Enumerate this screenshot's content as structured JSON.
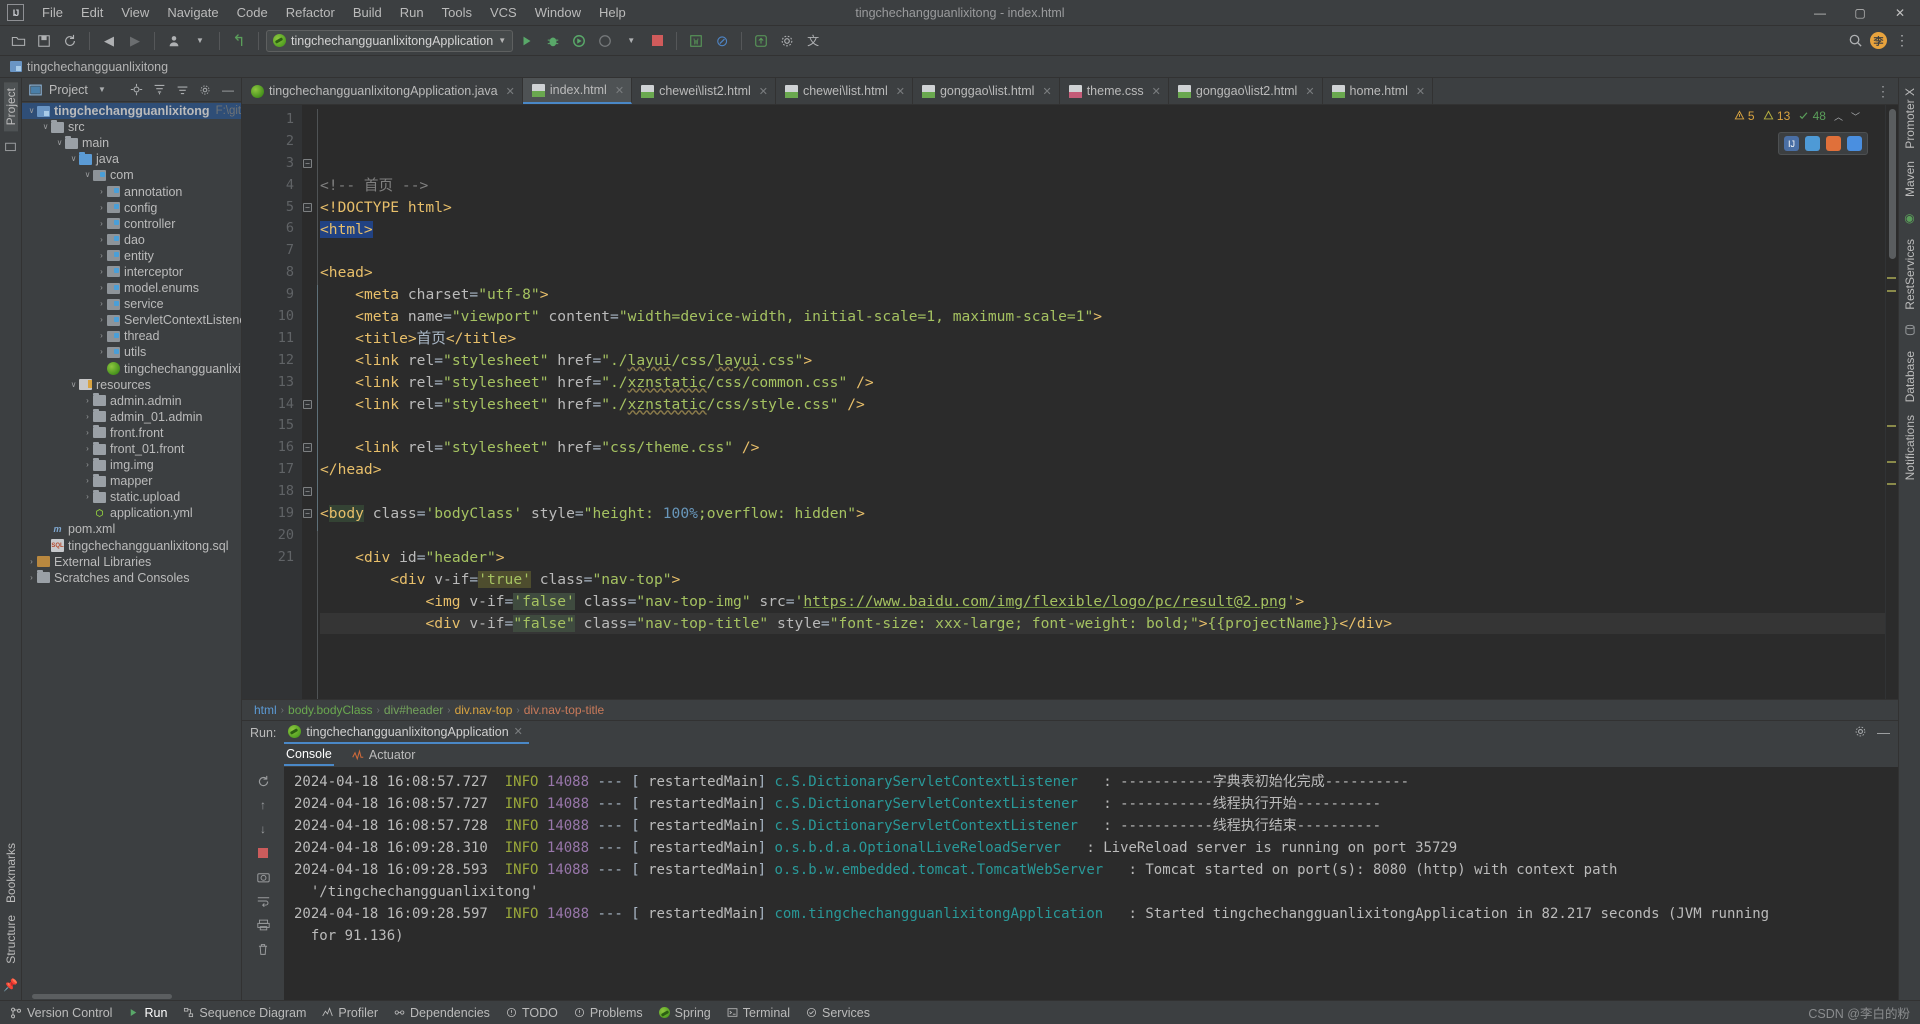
{
  "window": {
    "app_icon": "IJ",
    "title": "tingchechangguanlixitong - index.html",
    "minimize": "—",
    "maximize": "▢",
    "close": "✕"
  },
  "menu": [
    "File",
    "Edit",
    "View",
    "Navigate",
    "Code",
    "Refactor",
    "Build",
    "Run",
    "Tools",
    "VCS",
    "Window",
    "Help"
  ],
  "toolbar": {
    "open_icon": "open-folder-icon",
    "save_icon": "save-icon",
    "sync_icon": "sync-icon",
    "back_icon": "◀",
    "forward_icon": "▶",
    "profile_icon": "user-icon",
    "undo_icon": "↰",
    "run_config": "tingchechangguanlixitongApplication",
    "run_icon": "▶",
    "debug_icon": "debug-icon",
    "run_coverage_icon": "coverage-icon",
    "profiler_icon": "profiler-icon",
    "stop_icon": "stop-icon",
    "w_icon": "W",
    "ban_icon": "⊘",
    "update_icon": "update-icon",
    "settings_icon": "gear-icon",
    "translate_icon": "translate-icon",
    "search_icon": "search-icon",
    "avatar": "李"
  },
  "navbar": {
    "module": "tingchechangguanlixitong"
  },
  "left_rail": {
    "project_label": "Project",
    "structure_label": "Structure",
    "bookmarks_label": "Bookmarks"
  },
  "right_rail": {
    "items": [
      "Promoter X",
      "Maven",
      "RestServices",
      "Database",
      "Notifications"
    ]
  },
  "project_panel": {
    "title": "Project",
    "icons": [
      "locate-icon",
      "expand-all-icon",
      "collapse-all-icon",
      "gear-icon",
      "hide-icon"
    ],
    "tree": [
      {
        "label": "tingchechangguanlixitong",
        "path": "F:\\gitee_w",
        "depth": 0,
        "arrow": "v",
        "icon": "f-mod",
        "selected": true,
        "bold": true
      },
      {
        "label": "src",
        "depth": 1,
        "arrow": "v",
        "icon": "f-gray"
      },
      {
        "label": "main",
        "depth": 2,
        "arrow": "v",
        "icon": "f-gray"
      },
      {
        "label": "java",
        "depth": 3,
        "arrow": "v",
        "icon": "f-blue"
      },
      {
        "label": "com",
        "depth": 4,
        "arrow": "v",
        "icon": "f-pkg"
      },
      {
        "label": "annotation",
        "depth": 5,
        "arrow": ">",
        "icon": "f-pkg"
      },
      {
        "label": "config",
        "depth": 5,
        "arrow": ">",
        "icon": "f-pkg"
      },
      {
        "label": "controller",
        "depth": 5,
        "arrow": ">",
        "icon": "f-pkg"
      },
      {
        "label": "dao",
        "depth": 5,
        "arrow": ">",
        "icon": "f-pkg"
      },
      {
        "label": "entity",
        "depth": 5,
        "arrow": ">",
        "icon": "f-pkg"
      },
      {
        "label": "interceptor",
        "depth": 5,
        "arrow": ">",
        "icon": "f-pkg"
      },
      {
        "label": "model.enums",
        "depth": 5,
        "arrow": ">",
        "icon": "f-pkg"
      },
      {
        "label": "service",
        "depth": 5,
        "arrow": ">",
        "icon": "f-pkg"
      },
      {
        "label": "ServletContextListener",
        "depth": 5,
        "arrow": ">",
        "icon": "f-pkg"
      },
      {
        "label": "thread",
        "depth": 5,
        "arrow": ">",
        "icon": "f-pkg"
      },
      {
        "label": "utils",
        "depth": 5,
        "arrow": ">",
        "icon": "f-pkg"
      },
      {
        "label": "tingchechangguanlixito",
        "depth": 5,
        "arrow": "",
        "icon": "spring"
      },
      {
        "label": "resources",
        "depth": 3,
        "arrow": "v",
        "icon": "f-res"
      },
      {
        "label": "admin.admin",
        "depth": 4,
        "arrow": ">",
        "icon": "f-gray"
      },
      {
        "label": "admin_01.admin",
        "depth": 4,
        "arrow": ">",
        "icon": "f-gray"
      },
      {
        "label": "front.front",
        "depth": 4,
        "arrow": ">",
        "icon": "f-gray"
      },
      {
        "label": "front_01.front",
        "depth": 4,
        "arrow": ">",
        "icon": "f-gray"
      },
      {
        "label": "img.img",
        "depth": 4,
        "arrow": ">",
        "icon": "f-gray"
      },
      {
        "label": "mapper",
        "depth": 4,
        "arrow": ">",
        "icon": "f-gray"
      },
      {
        "label": "static.upload",
        "depth": 4,
        "arrow": ">",
        "icon": "f-gray"
      },
      {
        "label": "application.yml",
        "depth": 4,
        "arrow": "",
        "icon": "yml"
      },
      {
        "label": "pom.xml",
        "depth": 1,
        "arrow": "",
        "icon": "xml"
      },
      {
        "label": "tingchechangguanlixitong.sql",
        "depth": 1,
        "arrow": "",
        "icon": "sql"
      },
      {
        "label": "External Libraries",
        "depth": 0,
        "arrow": ">",
        "icon": "f-lib"
      },
      {
        "label": "Scratches and Consoles",
        "depth": 0,
        "arrow": ">",
        "icon": "f-gray"
      }
    ]
  },
  "editor": {
    "tabs": [
      {
        "label": "tingchechangguanlixitongApplication.java",
        "icon": "spring-icon",
        "active": false
      },
      {
        "label": "index.html",
        "icon": "html-icon",
        "active": true
      },
      {
        "label": "chewei\\list2.html",
        "icon": "html-icon",
        "active": false
      },
      {
        "label": "chewei\\list.html",
        "icon": "html-icon",
        "active": false
      },
      {
        "label": "gonggao\\list.html",
        "icon": "html-icon",
        "active": false
      },
      {
        "label": "theme.css",
        "icon": "css-icon",
        "active": false
      },
      {
        "label": "gonggao\\list2.html",
        "icon": "html-icon",
        "active": false
      },
      {
        "label": "home.html",
        "icon": "html-icon",
        "active": false
      }
    ],
    "inspections": {
      "errors": "5",
      "warnings": "13",
      "weak": "48",
      "chevron_up": "︿",
      "chevron_down": "﹀"
    },
    "line_numbers": [
      "1",
      "2",
      "3",
      "4",
      "5",
      "6",
      "7",
      "8",
      "9",
      "10",
      "11",
      "12",
      "13",
      "14",
      "15",
      "16",
      "17",
      "18",
      "19",
      "20",
      "21"
    ],
    "breadcrumb": [
      "html",
      "body.bodyClass",
      "div#header",
      "div.nav-top",
      "div.nav-top-title"
    ],
    "code_lines": [
      "<!-- 首页 -->",
      "<!DOCTYPE html>",
      "<html>",
      "",
      "<head>",
      "    <meta charset=\"utf-8\">",
      "    <meta name=\"viewport\" content=\"width=device-width, initial-scale=1, maximum-scale=1\">",
      "    <title>首页</title>",
      "    <link rel=\"stylesheet\" href=\"./layui/css/layui.css\">",
      "    <link rel=\"stylesheet\" href=\"./xznstatic/css/common.css\" />",
      "    <link rel=\"stylesheet\" href=\"./xznstatic/css/style.css\" />",
      "",
      "    <link rel=\"stylesheet\" href=\"css/theme.css\" />",
      "</head>",
      "",
      "<body class='bodyClass' style=\"height: 100%;overflow: hidden\">",
      "",
      "    <div id=\"header\">",
      "        <div v-if='true' class=\"nav-top\">",
      "            <img v-if='false' class=\"nav-top-img\" src='https://www.baidu.com/img/flexible/logo/pc/result@2.png'>",
      "            <div v-if=\"false\" class=\"nav-top-title\" style=\"font-size: xxx-large; font-weight: bold;\">{{projectName}}</div>"
    ]
  },
  "run_panel": {
    "run_label": "Run:",
    "config_name": "tingchechangguanlixitongApplication",
    "close_icon": "✕",
    "settings_icon": "gear-icon",
    "minimize_icon": "—",
    "tabs": [
      {
        "label": "Console",
        "active": true
      },
      {
        "label": "Actuator",
        "active": false
      }
    ],
    "rail_icons": [
      "rerun-icon",
      "scroll-up-icon",
      "scroll-down-icon",
      "stop-icon",
      "camera-icon",
      "print-icon",
      "soft-wrap-icon",
      "trash-icon"
    ],
    "log_lines": [
      {
        "date": "2024-04-18 16:08:57.727",
        "level": "INFO",
        "pid": "14088",
        "thread": "restartedMain",
        "cls": "c.S.DictionaryServletContextListener",
        "msg": ": -----------字典表初始化完成----------"
      },
      {
        "date": "2024-04-18 16:08:57.727",
        "level": "INFO",
        "pid": "14088",
        "thread": "restartedMain",
        "cls": "c.S.DictionaryServletContextListener",
        "msg": ": -----------线程执行开始----------"
      },
      {
        "date": "2024-04-18 16:08:57.728",
        "level": "INFO",
        "pid": "14088",
        "thread": "restartedMain",
        "cls": "c.S.DictionaryServletContextListener",
        "msg": ": -----------线程执行结束----------"
      },
      {
        "date": "2024-04-18 16:09:28.310",
        "level": "INFO",
        "pid": "14088",
        "thread": "restartedMain",
        "cls": "o.s.b.d.a.OptionalLiveReloadServer",
        "msg": ": LiveReload server is running on port 35729"
      },
      {
        "date": "2024-04-18 16:09:28.593",
        "level": "INFO",
        "pid": "14088",
        "thread": "restartedMain",
        "cls": "o.s.b.w.embedded.tomcat.TomcatWebServer",
        "msg": ": Tomcat started on port(s): 8080 (http) with context path"
      },
      {
        "date": "",
        "level": "",
        "pid": "",
        "thread": "",
        "cls": "",
        "msg": "  '/tingchechangguanlixitong'"
      },
      {
        "date": "2024-04-18 16:09:28.597",
        "level": "INFO",
        "pid": "14088",
        "thread": "restartedMain",
        "cls": "com.tingchechangguanlixitongApplication",
        "msg": ": Started tingchechangguanlixitongApplication in 82.217 seconds (JVM running"
      },
      {
        "date": "",
        "level": "",
        "pid": "",
        "thread": "",
        "cls": "",
        "msg": "  for 91.136)"
      }
    ]
  },
  "status_bar": {
    "items": [
      {
        "label": "Version Control",
        "icon": "branch-icon"
      },
      {
        "label": "Run",
        "icon": "run-icon"
      },
      {
        "label": "Sequence Diagram",
        "icon": "diagram-icon"
      },
      {
        "label": "Profiler",
        "icon": "profiler-icon"
      },
      {
        "label": "Dependencies",
        "icon": "deps-icon"
      },
      {
        "label": "TODO",
        "icon": "todo-icon"
      },
      {
        "label": "Problems",
        "icon": "problems-icon"
      },
      {
        "label": "Spring",
        "icon": "spring-icon"
      },
      {
        "label": "Terminal",
        "icon": "terminal-icon"
      },
      {
        "label": "Services",
        "icon": "services-icon"
      }
    ],
    "watermark": "CSDN @李白的粉"
  }
}
